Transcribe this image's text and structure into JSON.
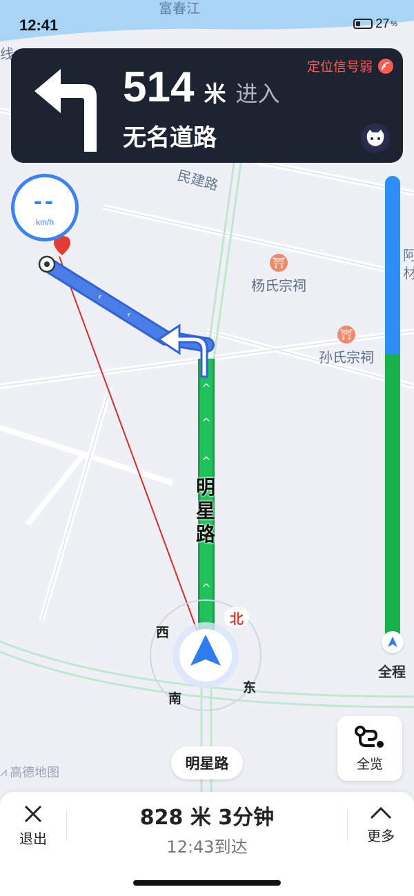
{
  "status_bar": {
    "time": "12:41",
    "battery_percent": "27",
    "battery_symbol": "%"
  },
  "map": {
    "river_label": "富春江",
    "road_label_top": "民建路",
    "road_label_main": [
      "明",
      "星",
      "路"
    ],
    "edge_label_left": "线",
    "edge_label_right": [
      "阿",
      "材"
    ],
    "pois": [
      "杨氏宗祠",
      "孙氏宗祠"
    ],
    "compass": {
      "north": "北",
      "south": "南",
      "east": "东",
      "west": "西"
    },
    "watermark": "高德地图"
  },
  "navigation": {
    "distance_value": "514",
    "distance_unit": "米",
    "action": "进入",
    "next_road": "无名道路",
    "signal_warning": "定位信号弱"
  },
  "speed": {
    "value": "--",
    "unit": "km/h"
  },
  "route_progress": {
    "label": "全程",
    "completed_fraction": 0.38
  },
  "overview_button": {
    "label": "全览"
  },
  "current_road": "明星路",
  "bottom_bar": {
    "exit_label": "退出",
    "summary": "828 米 3分钟",
    "eta": "12:43到达",
    "more_label": "更多"
  },
  "colors": {
    "accent": "#3a82f7",
    "route_green": "#17b34a",
    "warning": "#ff5a4f",
    "card_bg": "#1d2330"
  }
}
